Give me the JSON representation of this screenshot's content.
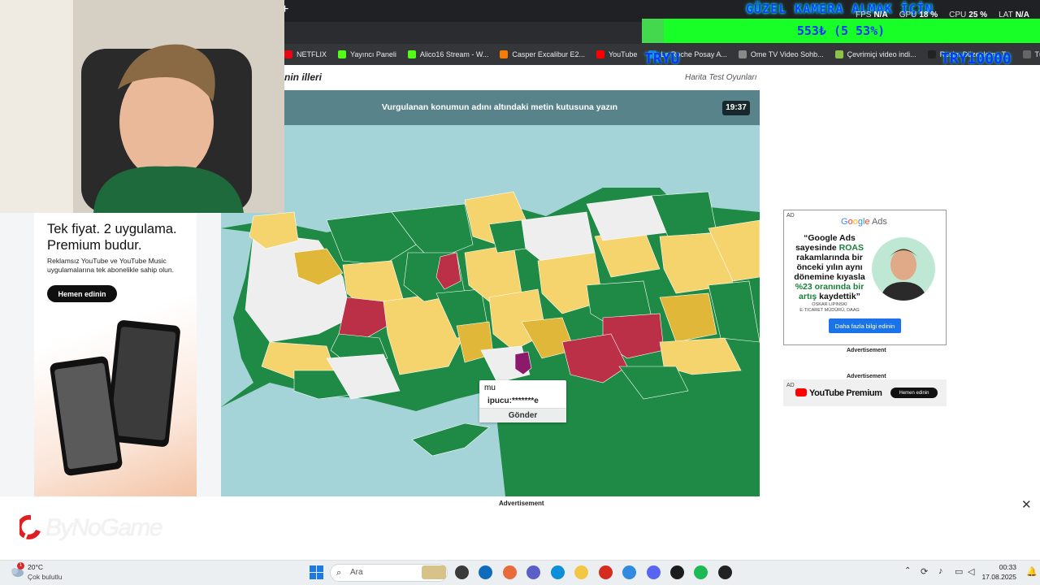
{
  "overlay": {
    "title": "GÜZEL KAMERA ALMAK İÇİN",
    "stats": [
      {
        "label": "FPS",
        "value": "N/A"
      },
      {
        "label": "GPU",
        "value": "18 %"
      },
      {
        "label": "CPU",
        "value": "25 %"
      },
      {
        "label": "LAT",
        "value": "N/A"
      }
    ],
    "goal_text": "553₺ (5 53%)",
    "goal_progress": 0.0553,
    "tryu_left": "TRYU",
    "tryu_right": "TRY10000",
    "ext_badge": "1"
  },
  "bookmarks": [
    {
      "label": "NETFLIX",
      "color": "#e50914"
    },
    {
      "label": "Yayıncı Paneli",
      "color": "#53fc18"
    },
    {
      "label": "Alico16 Stream - W...",
      "color": "#53fc18"
    },
    {
      "label": "Casper Excalibur E2...",
      "color": "#f57c00"
    },
    {
      "label": "YouTube",
      "color": "#ff0000"
    },
    {
      "label": "La Roche Posay A...",
      "color": "#1976d2"
    },
    {
      "label": "Ome TV Video Sohb...",
      "color": "#888888"
    },
    {
      "label": "Çevrimiçi video indi...",
      "color": "#8bc34a"
    },
    {
      "label": "Resim Düzenleme T...",
      "color": "#222222"
    },
    {
      "label": "Tüm Yer İşaretleri",
      "color": "#666666"
    }
  ],
  "page": {
    "crumb": "nin illeri",
    "crumb_right": "Harita Test Oyunları"
  },
  "game": {
    "instruction": "Vurgulanan konumun adını altındaki metin kutusuna yazın",
    "timer": "19:37",
    "answer_value": "mu",
    "hint": "ipucu:*******e",
    "submit_label": "Gönder",
    "colors": {
      "sea": "#a5d4d8",
      "land": "#1f8a45",
      "yellow": "#f5d46e",
      "gold": "#e1b73a",
      "red": "#bb3046",
      "gray": "#eeeeee",
      "highlight": "#8b1a6b"
    }
  },
  "left_ad": {
    "title": "Tek fiyat. 2 uygulama. Premium budur.",
    "body": "Reklamsız YouTube ve YouTube Music uygulamalarına tek abonelikle sahip olun.",
    "cta": "Hemen edinin"
  },
  "right_ads": {
    "ad_tag": "AD",
    "google_brand": "Google Ads",
    "quote_parts": [
      "“Google Ads sayesinde ",
      "ROAS",
      " rakamlarında bir önceki yılın aynı dönemine kıyasla ",
      "%23 oranında bir artış",
      " kaydettik”"
    ],
    "person": "OSKAR LIPINSKI",
    "person_title": "E-TICARET MÜDÜRÜ, DAAG",
    "cta": "Daha fazla bilgi edinin",
    "advertisement_1": "Advertisement",
    "advertisement_2": "Advertisement",
    "yt_premium": "YouTube Premium",
    "yt_cta": "Hemen edinin"
  },
  "bottom_ad": {
    "label": "Advertisement",
    "brand": "ByNoGame"
  },
  "taskbar": {
    "temp": "20°C",
    "weather": "Çok bulutlu",
    "weather_badge": "1",
    "search": "Ara",
    "time": "00:33",
    "date": "17.08.2025"
  }
}
